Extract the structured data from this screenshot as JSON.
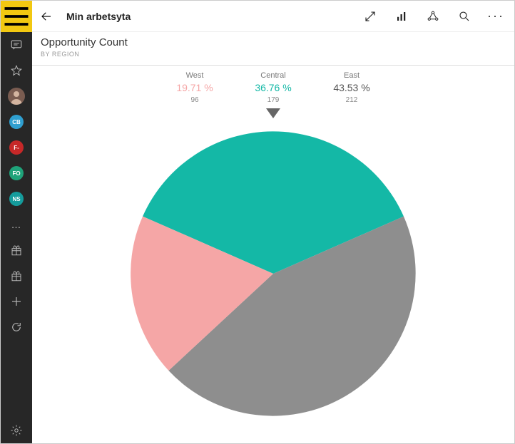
{
  "app_title": "Min arbetsyta",
  "chart_title": "Opportunity Count",
  "chart_subtitle": "BY REGION",
  "sidebar_badges": {
    "cb": "CB",
    "f": "F-",
    "fo": "FO",
    "ns": "NS"
  },
  "colors": {
    "west": "#f5a6a6",
    "central": "#14b8a6",
    "east": "#8e8e8e"
  },
  "legend": {
    "west": {
      "name": "West",
      "pct": "19.71 %",
      "count": "96"
    },
    "central": {
      "name": "Central",
      "pct": "36.76 %",
      "count": "179"
    },
    "east": {
      "name": "East",
      "pct": "43.53 %",
      "count": "212"
    }
  },
  "chart_data": {
    "type": "pie",
    "title": "Opportunity Count",
    "subtitle": "BY REGION",
    "categories": [
      "West",
      "Central",
      "East"
    ],
    "values": [
      96,
      179,
      212
    ],
    "percentages": [
      19.71,
      36.76,
      43.53
    ],
    "colors": [
      "#f5a6a6",
      "#14b8a6",
      "#8e8e8e"
    ],
    "selected": "Central"
  }
}
